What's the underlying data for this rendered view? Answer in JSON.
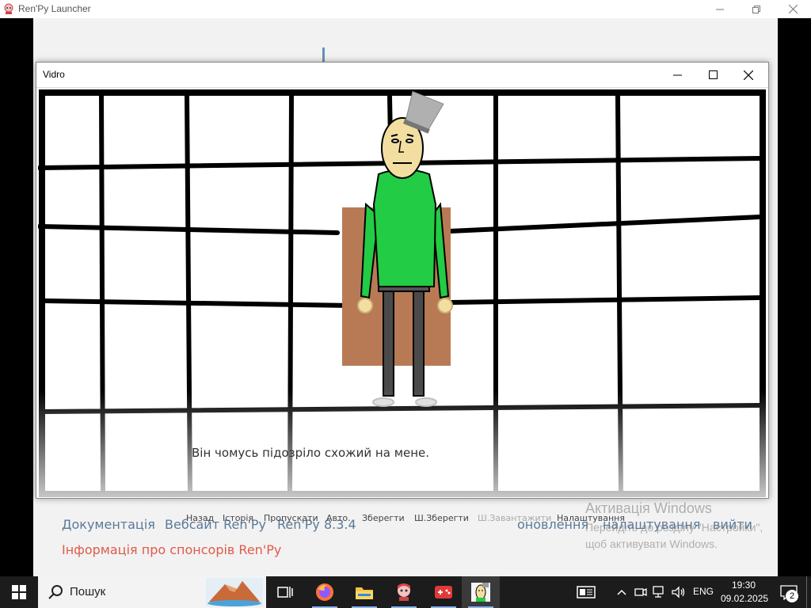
{
  "launcher": {
    "title": "Ren'Py Launcher",
    "footer": {
      "documentation": "Документація",
      "website": "Вебсайт Ren'Py",
      "version": "Ren'Py 8.3.4",
      "sponsors": "Інформація про спонсорів Ren'Py",
      "updates": "оновлення",
      "settings": "налаштування",
      "quit": "вийти"
    }
  },
  "windows_activation": {
    "title": "Активація Windows",
    "line1": "Перейдіть до розділу \"Настройки\",",
    "line2": "щоб активувати Windows."
  },
  "game_window": {
    "title": "Vidro",
    "dialogue": "Він чомусь підозріло схожий на мене.",
    "quick_menu": [
      {
        "label": "Назад"
      },
      {
        "label": "Історія"
      },
      {
        "label": "Пропускати"
      },
      {
        "label": "Авто."
      },
      {
        "label": "Зберегти"
      },
      {
        "label": "Ш.Зберегти"
      },
      {
        "label": "Ш.Завантажити"
      },
      {
        "label": "Налаштування"
      }
    ]
  },
  "taskbar": {
    "search_label": "Пошук",
    "language": "ENG",
    "time": "19:30",
    "date": "09.02.2025",
    "notification_count": "2"
  },
  "colors": {
    "character_shirt": "#22cc44",
    "character_skin": "#f2dea0",
    "backboard": "#b87a55",
    "bucket": "#b0b0b0",
    "link": "#5a7a99",
    "sponsor_link": "#e05a4a"
  }
}
